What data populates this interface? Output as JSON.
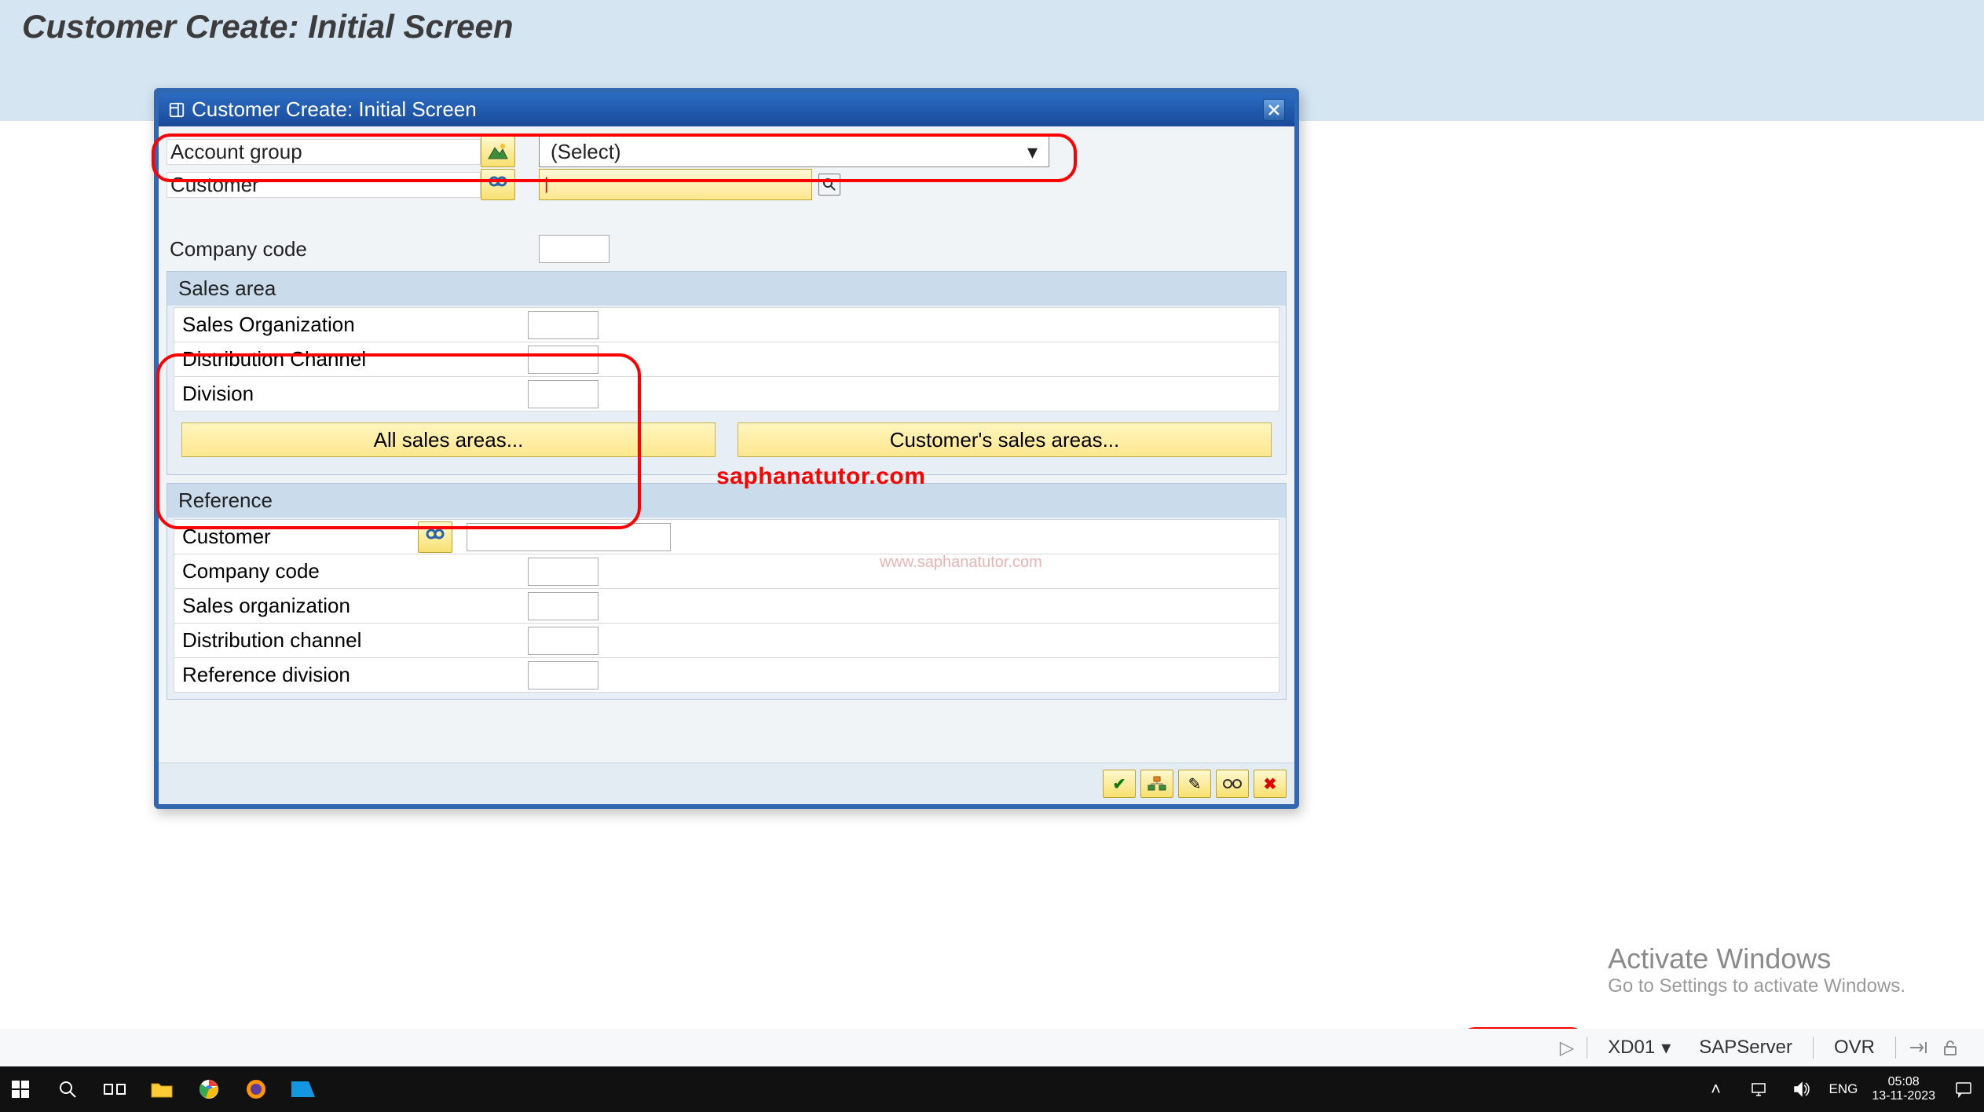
{
  "page_title": "Customer Create: Initial Screen",
  "dialog": {
    "title": "Customer Create: Initial Screen",
    "account_group_label": "Account group",
    "account_group_select_placeholder": "(Select)",
    "customer_label": "Customer",
    "customer_value": "",
    "company_code_label": "Company code",
    "company_code_value": "",
    "sales_area_header": "Sales area",
    "sales_org_label": "Sales Organization",
    "dist_channel_label": "Distribution Channel",
    "division_label": "Division",
    "all_sales_areas_btn": "All sales areas...",
    "cust_sales_areas_btn": "Customer's sales areas...",
    "reference_header": "Reference",
    "ref_customer_label": "Customer",
    "ref_company_code_label": "Company code",
    "ref_sales_org_label": "Sales organization",
    "ref_dist_channel_label": "Distribution channel",
    "ref_division_label": "Reference division"
  },
  "watermark": "saphanatutor.com",
  "watermark2": "www.saphanatutor.com",
  "activate_windows": {
    "title": "Activate Windows",
    "sub": "Go to Settings to activate Windows."
  },
  "footer": {
    "tcode": "XD01",
    "server": "SAPServer",
    "mode": "OVR"
  },
  "taskbar": {
    "lang": "ENG",
    "time": "05:08",
    "date": "13-11-2023"
  }
}
